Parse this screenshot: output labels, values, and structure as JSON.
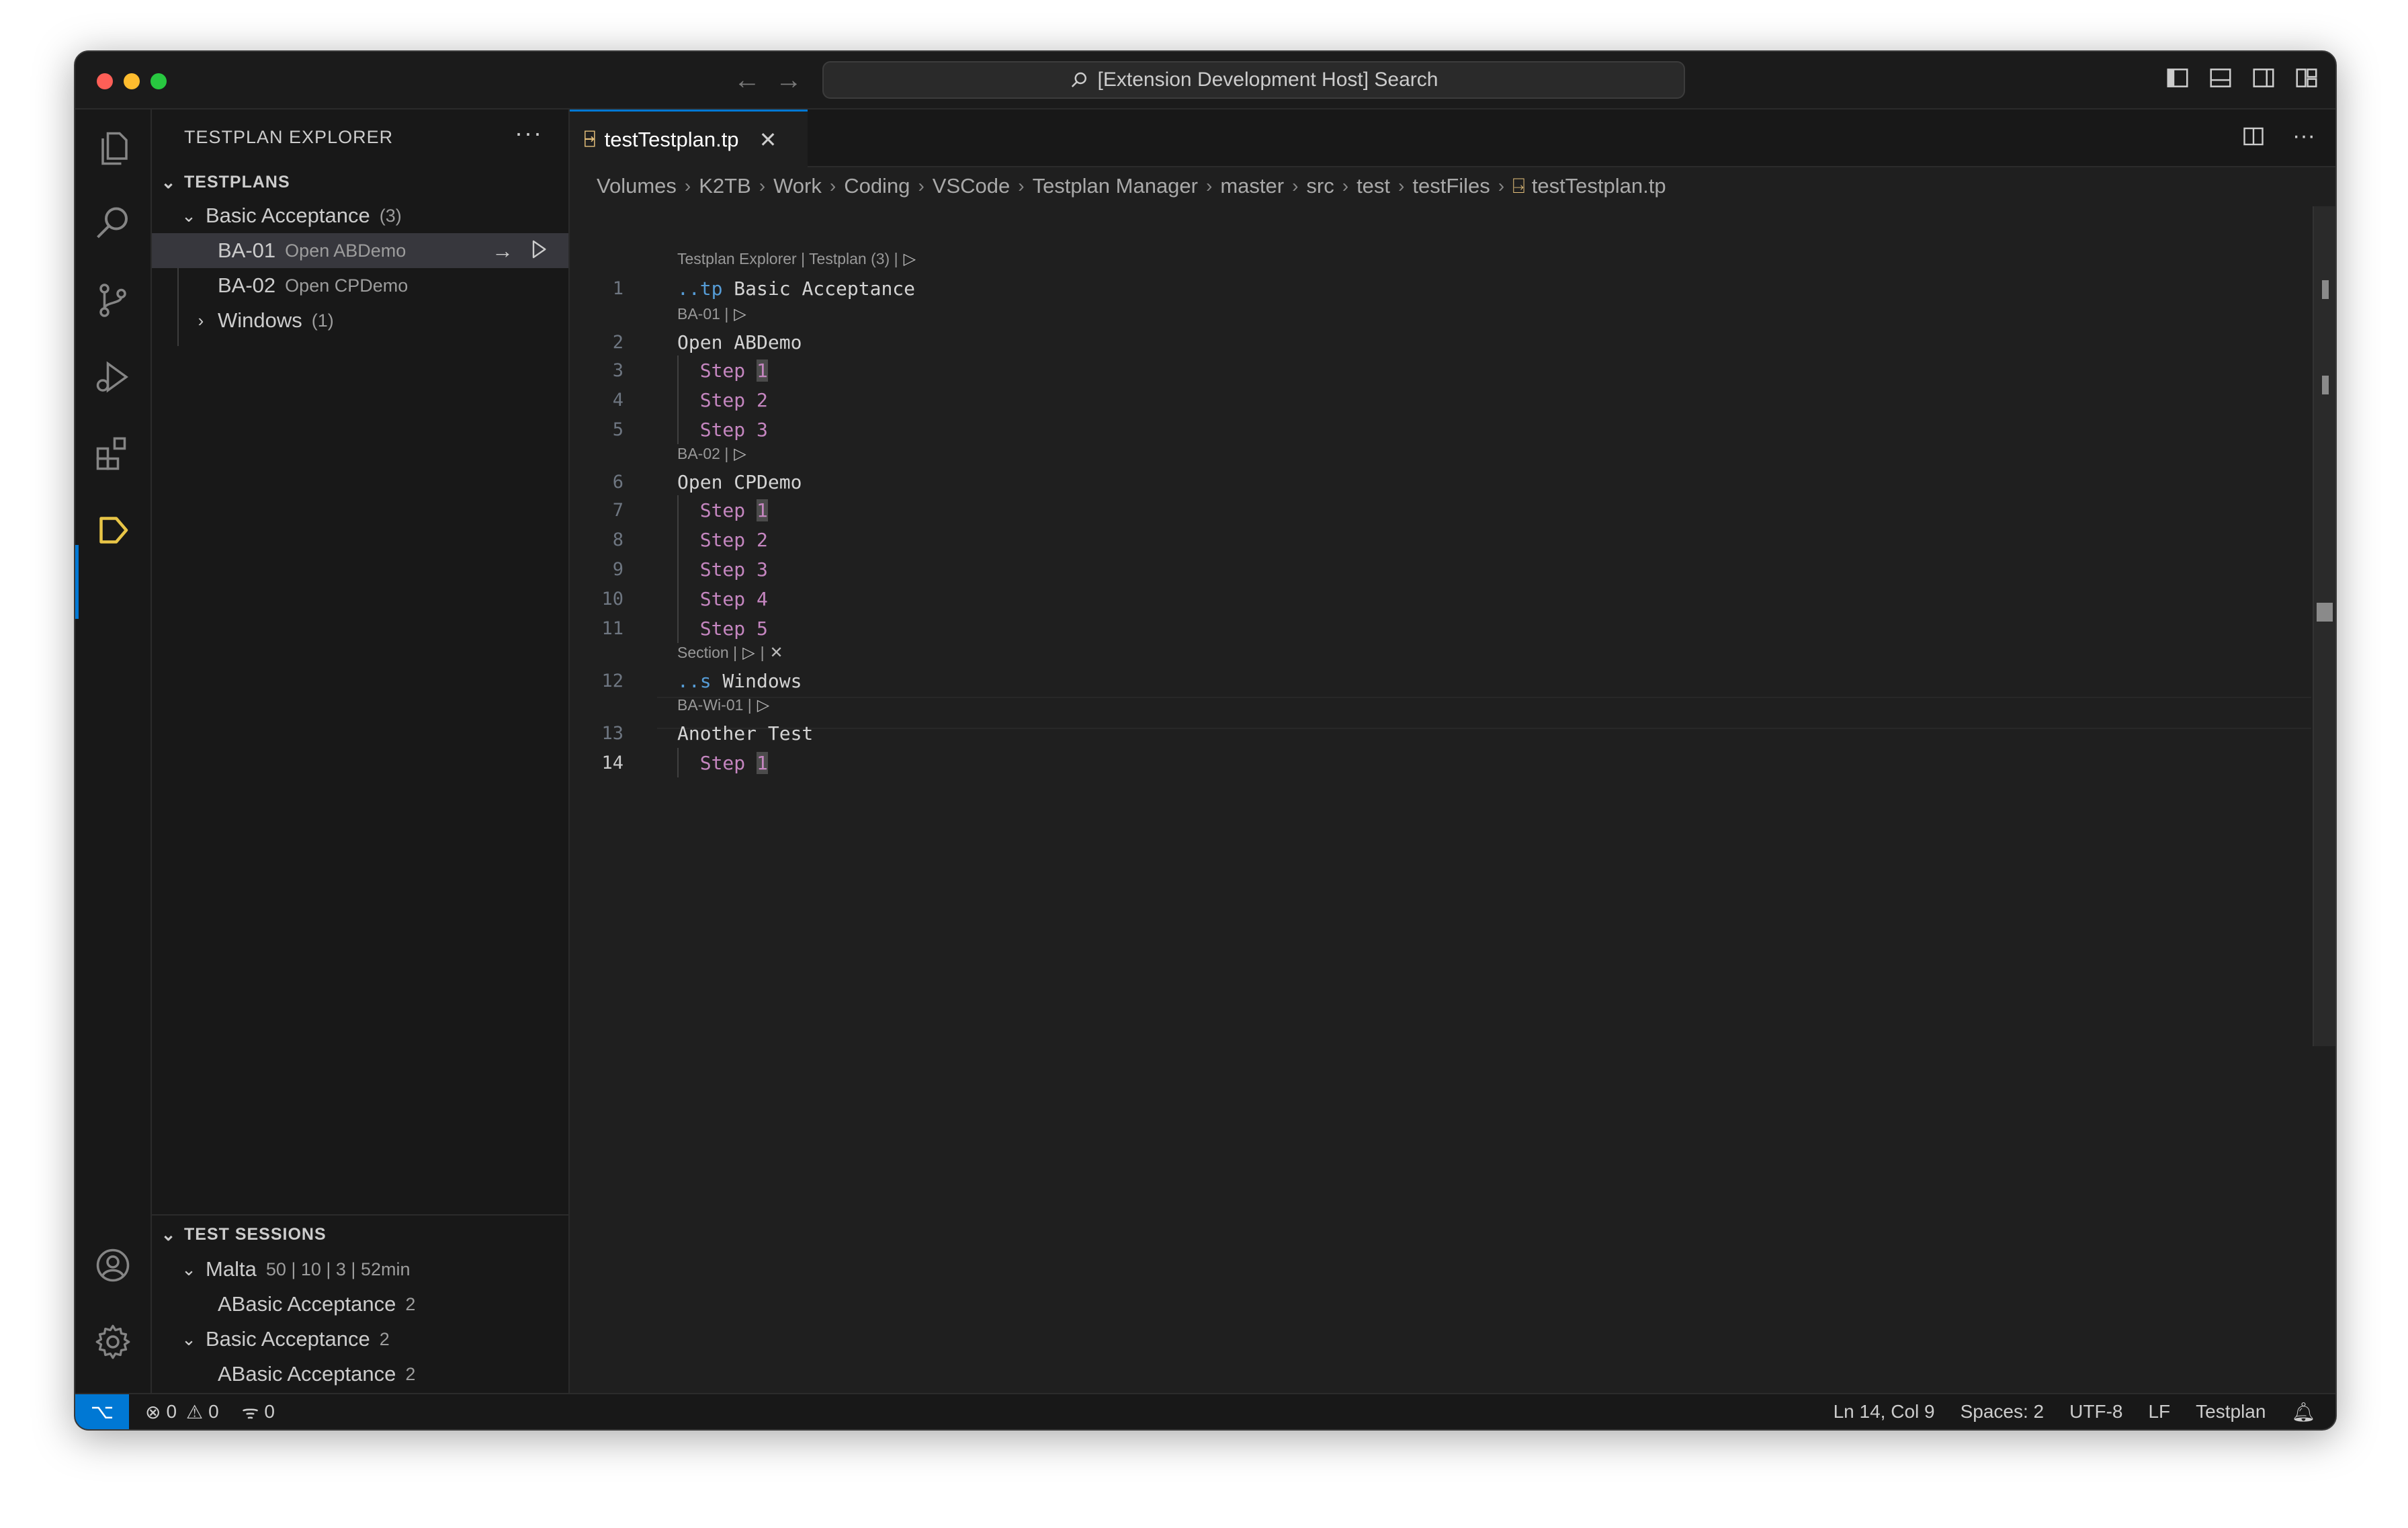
{
  "window": {
    "search": "[Extension Development Host] Search"
  },
  "sidebar": {
    "title": "TESTPLAN EXPLORER",
    "more": "···",
    "testplans": {
      "header": "TESTPLANS",
      "group": {
        "label": "Basic Acceptance",
        "count": "(3)"
      },
      "items": [
        {
          "id": "BA-01",
          "desc": "Open ABDemo"
        },
        {
          "id": "BA-02",
          "desc": "Open CPDemo"
        }
      ],
      "windows": {
        "label": "Windows",
        "count": "(1)"
      }
    },
    "sessions": {
      "header": "TEST SESSIONS",
      "items": [
        {
          "label": "Malta",
          "meta": "50 | 10 | 3 | 52min"
        },
        {
          "label": "ABasic Acceptance",
          "meta": "2"
        },
        {
          "label": "Basic Acceptance",
          "meta": "2"
        },
        {
          "label": "ABasic Acceptance",
          "meta": "2"
        }
      ]
    }
  },
  "tab": {
    "label": "testTestplan.tp",
    "icon_text": "⍈"
  },
  "breadcrumbs": [
    "Volumes",
    "K2TB",
    "Work",
    "Coding",
    "VSCode",
    "Testplan Manager",
    "master",
    "src",
    "test",
    "testFiles",
    "testTestplan.tp"
  ],
  "editor": {
    "lens_top": "Testplan Explorer | Testplan (3) |",
    "lens_ba01": "BA-01 |",
    "lens_ba02": "BA-02 |",
    "lens_section": "Section |",
    "lens_sep": "|",
    "lens_bawi": "BA-Wi-01 |",
    "lines": [
      {
        "n": "1",
        "prefix": "..tp",
        "text": " Basic Acceptance"
      },
      {
        "n": "2",
        "text": "Open ABDemo"
      },
      {
        "n": "3",
        "step": "Step",
        "num": "1"
      },
      {
        "n": "4",
        "step": "Step",
        "num": "2"
      },
      {
        "n": "5",
        "step": "Step",
        "num": "3"
      },
      {
        "n": "6",
        "text": "Open CPDemo"
      },
      {
        "n": "7",
        "step": "Step",
        "num": "1"
      },
      {
        "n": "8",
        "step": "Step",
        "num": "2"
      },
      {
        "n": "9",
        "step": "Step",
        "num": "3"
      },
      {
        "n": "10",
        "step": "Step",
        "num": "4"
      },
      {
        "n": "11",
        "step": "Step",
        "num": "5"
      },
      {
        "n": "12",
        "prefix": "..s",
        "text": " Windows"
      },
      {
        "n": "13",
        "text": "Another Test"
      },
      {
        "n": "14",
        "step": "Step",
        "num": "1"
      }
    ]
  },
  "status": {
    "errors": "0",
    "warnings": "0",
    "ports": "0",
    "position": "Ln 14, Col 9",
    "spaces": "Spaces: 2",
    "encoding": "UTF-8",
    "eol": "LF",
    "language": "Testplan"
  }
}
